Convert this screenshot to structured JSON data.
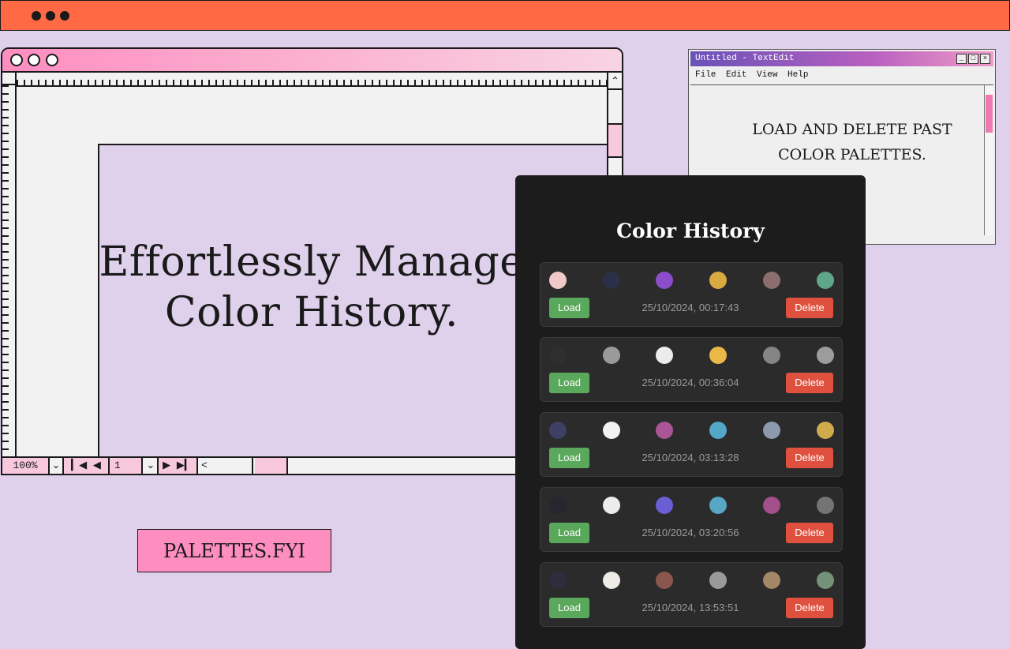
{
  "hero": {
    "line1": "Effortlessly Manage",
    "line2": "Color History."
  },
  "design_window": {
    "zoom": "100%",
    "page": "1"
  },
  "textedit": {
    "title": "Untitled - TextEdit",
    "menu": [
      "File",
      "Edit",
      "View",
      "Help"
    ],
    "body_line1": "LOAD AND DELETE PAST",
    "body_line2": "COLOR PALETTES."
  },
  "history": {
    "title": "Color History",
    "load_label": "Load",
    "delete_label": "Delete",
    "entries": [
      {
        "timestamp": "25/10/2024, 00:17:43",
        "colors": [
          "#f1c9c9",
          "#2b2f48",
          "#8b4dc9",
          "#d8aa42",
          "#8c6e6e",
          "#5fa68a"
        ]
      },
      {
        "timestamp": "25/10/2024, 00:36:04",
        "colors": [
          "#2f2f2f",
          "#9a9a9a",
          "#ececec",
          "#ebb848",
          "#858585",
          "#9c9c9c"
        ]
      },
      {
        "timestamp": "25/10/2024, 03:13:28",
        "colors": [
          "#3d3f63",
          "#f2f2f2",
          "#a95596",
          "#53a8c8",
          "#8d9aae",
          "#cfab4c"
        ]
      },
      {
        "timestamp": "25/10/2024, 03:20:56",
        "colors": [
          "#262631",
          "#ececec",
          "#6a5fd4",
          "#56a6c4",
          "#a44e8c",
          "#747474"
        ]
      },
      {
        "timestamp": "25/10/2024, 13:53:51",
        "colors": [
          "#312c3d",
          "#efebe6",
          "#8a574f",
          "#9a9a9a",
          "#a48668",
          "#749279"
        ]
      }
    ]
  },
  "brand": "PALETTES.FYI",
  "colors": {
    "accent_orange": "#ff6a45",
    "accent_pink": "#ff8ec0",
    "background": "#dfd0ec",
    "load_green": "#5aa85b",
    "delete_red": "#e0503e"
  }
}
